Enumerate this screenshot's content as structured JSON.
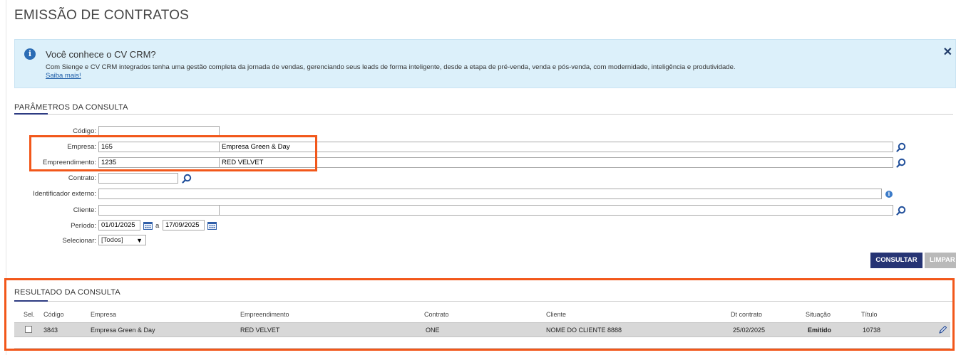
{
  "page": {
    "title": "EMISSÃO DE CONTRATOS"
  },
  "info_banner": {
    "title": "Você conhece o CV CRM?",
    "text": "Com Sienge e CV CRM integrados tenha uma gestão completa da jornada de vendas, gerenciando seus leads de forma inteligente, desde a etapa de pré-venda, venda e pós-venda, com modernidade, inteligência e produtividade.",
    "link": "Saiba mais!",
    "close": "✕"
  },
  "params": {
    "section_title": "PARÂMETROS DA CONSULTA",
    "fields": {
      "codigo": {
        "label": "Código:",
        "value": ""
      },
      "empresa": {
        "label": "Empresa:",
        "code": "165",
        "name": "Empresa Green & Day"
      },
      "empreendimento": {
        "label": "Empreendimento:",
        "code": "1235",
        "name": "RED VELVET"
      },
      "contrato": {
        "label": "Contrato:",
        "value": ""
      },
      "identificador": {
        "label": "Identificador externo:",
        "value": ""
      },
      "cliente": {
        "label": "Cliente:",
        "code": "",
        "name": ""
      },
      "periodo": {
        "label": "Período:",
        "start": "01/01/2025",
        "separator": "a",
        "end": "17/09/2025"
      },
      "selecionar": {
        "label": "Selecionar:",
        "selected": "[Todos]"
      }
    },
    "buttons": {
      "consultar": "CONSULTAR",
      "limpar": "LIMPAR"
    }
  },
  "results": {
    "section_title": "RESULTADO DA CONSULTA",
    "columns": [
      "Sel.",
      "Código",
      "Empresa",
      "Empreendimento",
      "Contrato",
      "Cliente",
      "Dt contrato",
      "Situação",
      "Título"
    ],
    "rows": [
      {
        "codigo": "3843",
        "empresa": "Empresa Green & Day",
        "empreendimento": "RED VELVET",
        "contrato": "ONE",
        "cliente": "NOME DO CLIENTE 8888",
        "dt_contrato": "25/02/2025",
        "situacao": "Emitido",
        "titulo": "10738"
      }
    ]
  },
  "icons": {
    "info": "info-icon",
    "close": "close-icon",
    "lookup": "search-icon",
    "calendar": "calendar-icon",
    "edit": "edit-pencil-icon"
  },
  "colors": {
    "accent": "#263474",
    "highlight": "#f2571a",
    "banner_bg": "#dcf0fa",
    "row_bg": "#d8d8d8"
  }
}
